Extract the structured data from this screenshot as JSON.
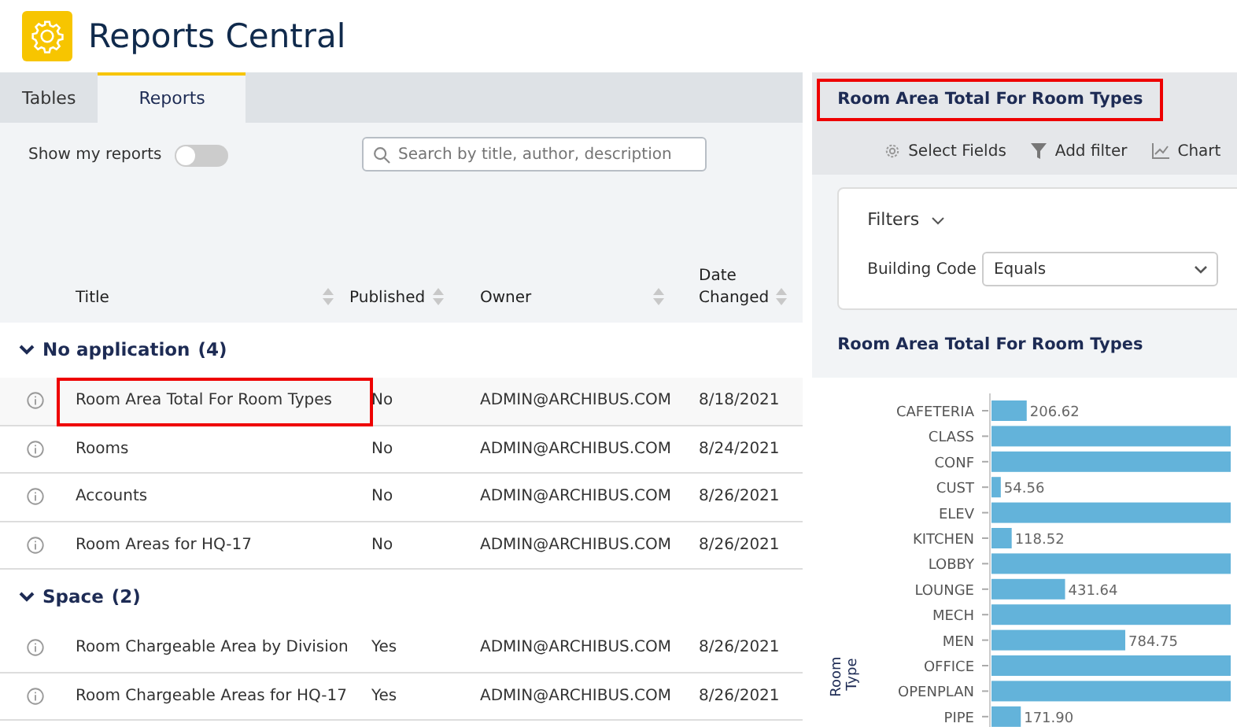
{
  "app": {
    "title": "Reports Central"
  },
  "tabs": [
    {
      "label": "Tables",
      "selected": false
    },
    {
      "label": "Reports",
      "selected": true
    }
  ],
  "show_my_reports": {
    "label": "Show my reports",
    "on": false
  },
  "search": {
    "placeholder": "Search by title, author, description"
  },
  "table": {
    "columns": [
      "Title",
      "Published",
      "Owner",
      "Date Changed"
    ],
    "groups": [
      {
        "name": "No application",
        "count": "(4)",
        "expanded": true,
        "rows": [
          {
            "title": "Room Area Total For Room Types",
            "published": "No",
            "owner": "ADMIN@ARCHIBUS.COM",
            "date": "8/18/2021",
            "highlighted": true
          },
          {
            "title": "Rooms",
            "published": "No",
            "owner": "ADMIN@ARCHIBUS.COM",
            "date": "8/24/2021",
            "highlighted": false
          },
          {
            "title": "Accounts",
            "published": "No",
            "owner": "ADMIN@ARCHIBUS.COM",
            "date": "8/26/2021",
            "highlighted": false
          },
          {
            "title": "Room Areas for HQ-17",
            "published": "No",
            "owner": "ADMIN@ARCHIBUS.COM",
            "date": "8/26/2021",
            "highlighted": false
          }
        ]
      },
      {
        "name": "Space",
        "count": "(2)",
        "expanded": true,
        "rows": [
          {
            "title": "Room Chargeable Area by Division",
            "published": "Yes",
            "owner": "ADMIN@ARCHIBUS.COM",
            "date": "8/26/2021",
            "highlighted": false
          },
          {
            "title": "Room Chargeable Areas for HQ-17",
            "published": "Yes",
            "owner": "ADMIN@ARCHIBUS.COM",
            "date": "8/26/2021",
            "highlighted": false
          }
        ]
      }
    ]
  },
  "report": {
    "title": "Room Area Total For Room Types",
    "title_highlighted": true,
    "toolbar": [
      {
        "kind": "gear",
        "label": "Select Fields"
      },
      {
        "kind": "filter",
        "label": "Add filter"
      },
      {
        "kind": "chart",
        "label": "Chart"
      }
    ],
    "filters": {
      "label": "Filters",
      "field": "Building Code",
      "operator": "Equals"
    },
    "chart_title": "Room Area Total For Room Types",
    "axis_title": "Room Type",
    "bars": [
      {
        "label": "CAFETERIA",
        "value_label": "206.62",
        "clipped": false
      },
      {
        "label": "CLASS",
        "clipped": true
      },
      {
        "label": "CONF",
        "clipped": true
      },
      {
        "label": "CUST",
        "value_label": "54.56",
        "clipped": false
      },
      {
        "label": "ELEV",
        "clipped": true
      },
      {
        "label": "KITCHEN",
        "value_label": "118.52",
        "clipped": false
      },
      {
        "label": "LOBBY",
        "clipped": true
      },
      {
        "label": "LOUNGE",
        "value_label": "431.64",
        "clipped": false
      },
      {
        "label": "MECH",
        "clipped": true
      },
      {
        "label": "MEN",
        "value_label": "784.75",
        "clipped": false
      },
      {
        "label": "OFFICE",
        "clipped": true
      },
      {
        "label": "OPENPLAN",
        "clipped": true
      },
      {
        "label": "PIPE",
        "value_label": "171.90",
        "clipped": false
      }
    ]
  }
}
